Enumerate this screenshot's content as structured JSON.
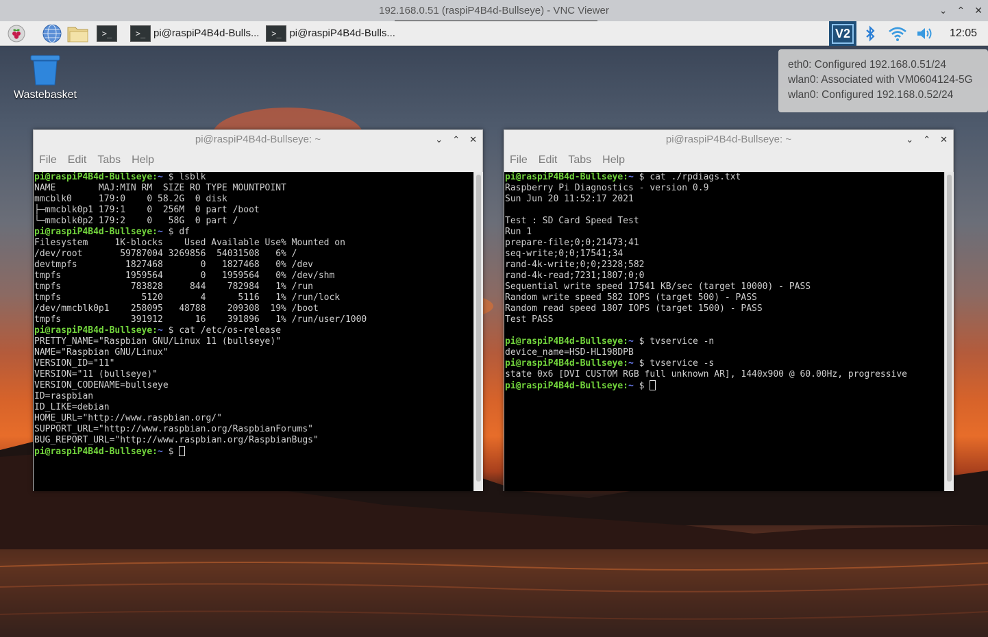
{
  "vnc": {
    "title": "192.168.0.51 (raspiP4B4d-Bullseye) - VNC Viewer"
  },
  "panel": {
    "launchers": [
      "raspberry-menu-icon",
      "web-browser-icon",
      "file-manager-icon",
      "terminal-icon"
    ],
    "tasks": [
      {
        "label": "pi@raspiP4B4d-Bulls..."
      },
      {
        "label": "pi@raspiP4B4d-Bulls..."
      }
    ],
    "vnc_label": "V2",
    "clock": "12:05"
  },
  "desktop": {
    "wastebasket_label": "Wastebasket"
  },
  "network_popup": {
    "lines": [
      "eth0: Configured 192.168.0.51/24",
      "wlan0: Associated with VM0604124-5G",
      "wlan0: Configured 192.168.0.52/24"
    ]
  },
  "terminals": [
    {
      "title": "pi@raspiP4B4d-Bullseye: ~",
      "menu": [
        "File",
        "Edit",
        "Tabs",
        "Help"
      ],
      "lines": [
        {
          "prompt": true,
          "cmd": "lsblk"
        },
        {
          "text": "NAME        MAJ:MIN RM  SIZE RO TYPE MOUNTPOINT"
        },
        {
          "text": "mmcblk0     179:0    0 58.2G  0 disk"
        },
        {
          "text": "├─mmcblk0p1 179:1    0  256M  0 part /boot"
        },
        {
          "text": "└─mmcblk0p2 179:2    0   58G  0 part /"
        },
        {
          "prompt": true,
          "cmd": "df"
        },
        {
          "text": "Filesystem     1K-blocks    Used Available Use% Mounted on"
        },
        {
          "text": "/dev/root       59787004 3269856  54031508   6% /"
        },
        {
          "text": "devtmpfs         1827468       0   1827468   0% /dev"
        },
        {
          "text": "tmpfs            1959564       0   1959564   0% /dev/shm"
        },
        {
          "text": "tmpfs             783828     844    782984   1% /run"
        },
        {
          "text": "tmpfs               5120       4      5116   1% /run/lock"
        },
        {
          "text": "/dev/mmcblk0p1    258095   48788    209308  19% /boot"
        },
        {
          "text": "tmpfs             391912      16    391896   1% /run/user/1000"
        },
        {
          "prompt": true,
          "cmd": "cat /etc/os-release"
        },
        {
          "text": "PRETTY_NAME=\"Raspbian GNU/Linux 11 (bullseye)\""
        },
        {
          "text": "NAME=\"Raspbian GNU/Linux\""
        },
        {
          "text": "VERSION_ID=\"11\""
        },
        {
          "text": "VERSION=\"11 (bullseye)\""
        },
        {
          "text": "VERSION_CODENAME=bullseye"
        },
        {
          "text": "ID=raspbian"
        },
        {
          "text": "ID_LIKE=debian"
        },
        {
          "text": "HOME_URL=\"http://www.raspbian.org/\""
        },
        {
          "text": "SUPPORT_URL=\"http://www.raspbian.org/RaspbianForums\""
        },
        {
          "text": "BUG_REPORT_URL=\"http://www.raspbian.org/RaspbianBugs\""
        },
        {
          "prompt": true,
          "cmd": "",
          "cursor": true
        }
      ]
    },
    {
      "title": "pi@raspiP4B4d-Bullseye: ~",
      "menu": [
        "File",
        "Edit",
        "Tabs",
        "Help"
      ],
      "lines": [
        {
          "prompt": true,
          "cmd": "cat ./rpdiags.txt"
        },
        {
          "text": "Raspberry Pi Diagnostics - version 0.9"
        },
        {
          "text": "Sun Jun 20 11:52:17 2021"
        },
        {
          "text": ""
        },
        {
          "text": "Test : SD Card Speed Test"
        },
        {
          "text": "Run 1"
        },
        {
          "text": "prepare-file;0;0;21473;41"
        },
        {
          "text": "seq-write;0;0;17541;34"
        },
        {
          "text": "rand-4k-write;0;0;2328;582"
        },
        {
          "text": "rand-4k-read;7231;1807;0;0"
        },
        {
          "text": "Sequential write speed 17541 KB/sec (target 10000) - PASS"
        },
        {
          "text": "Random write speed 582 IOPS (target 500) - PASS"
        },
        {
          "text": "Random read speed 1807 IOPS (target 1500) - PASS"
        },
        {
          "text": "Test PASS"
        },
        {
          "text": ""
        },
        {
          "prompt": true,
          "cmd": "tvservice -n"
        },
        {
          "text": "device_name=HSD-HL198DPB"
        },
        {
          "prompt": true,
          "cmd": "tvservice -s"
        },
        {
          "text": "state 0x6 [DVI CUSTOM RGB full unknown AR], 1440x900 @ 60.00Hz, progressive"
        },
        {
          "prompt": true,
          "cmd": "",
          "cursor": true
        }
      ]
    }
  ],
  "prompt": {
    "user_host": "pi@raspiP4B4d-Bullseye",
    "sep": ":",
    "path": "~",
    "symbol": "$"
  },
  "colors": {
    "prompt_user": "#72d43c",
    "prompt_path": "#6a7cf0",
    "terminal_bg": "#000000",
    "panel_bg": "#ededed"
  }
}
